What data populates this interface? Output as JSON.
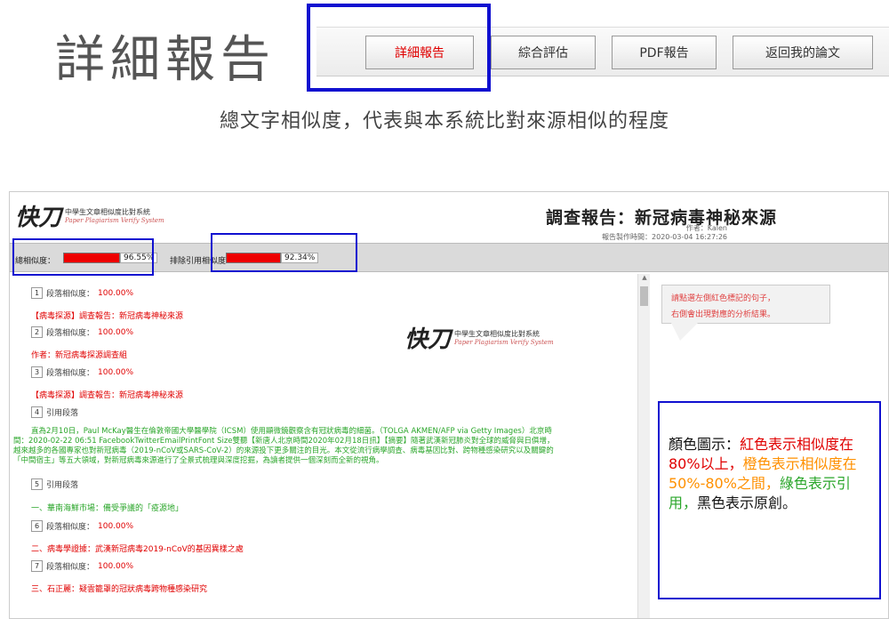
{
  "header": {
    "title": "詳細報告",
    "nav": [
      "詳細報告",
      "綜合評估",
      "PDF報告",
      "返回我的論文"
    ],
    "active_color": "#e00000"
  },
  "subtitle": "總文字相似度，代表與本系統比對來源相似的程度",
  "report": {
    "logo": {
      "mark": "快刀",
      "line1": "中學生文章相似度比對系統",
      "line2": "Paper Plagiarism Verify System"
    },
    "title": "調查報告：新冠病毒神秘來源",
    "author": "作者：Kalen",
    "created": "報告製作時間：2020-03-04 16:27:26",
    "similarity": {
      "total_label": "總相似度：",
      "total_value": "96.55%",
      "total_fraction": 0.9655,
      "excl_label": "排除引用相似度",
      "excl_value": "92.34%",
      "excl_fraction": 0.9234
    },
    "paragraphs": [
      {
        "num": "1",
        "label": "段落相似度：",
        "value": "100.00%",
        "text": "【病毒探源】調查報告：新冠病毒神秘來源"
      },
      {
        "num": "2",
        "label": "段落相似度：",
        "value": "100.00%",
        "text": "作者：新冠病毒探源調查組"
      },
      {
        "num": "3",
        "label": "段落相似度：",
        "value": "100.00%",
        "text": "【病毒探源】調查報告：新冠病毒神秘來源"
      },
      {
        "num": "4",
        "label": "引用段落",
        "value": "",
        "text": ""
      },
      {
        "num": "5",
        "label": "引用段落",
        "value": "",
        "text": "一、華南海鮮市場：備受爭議的「疫源地」"
      },
      {
        "num": "6",
        "label": "段落相似度：",
        "value": "100.00%",
        "text": "二、病毒學證據：武漢新冠病毒2019-nCoV的基因異樣之處"
      },
      {
        "num": "7",
        "label": "段落相似度：",
        "value": "100.00%",
        "text": "三、石正麗：疑雲籠罩的冠狀病毒跨物種感染研究"
      }
    ],
    "quote_lines": [
      "直為2月10日，Paul McKay醫生在倫敦帝國大學醫學院（ICSM）使用顯微鏡觀察含有冠狀病毒的細菌。（TOLGA AKMEN/AFP via Getty Images）北京時",
      "間：2020-02-22 06:51 FacebookTwitterEmailPrintFont Size雙聽【新唐人北京時間2020年02月18日訊】【摘要】隨著武漢新冠肺炎對全球的威脅與日俱增，",
      "越來越多的各國專家也對新冠病毒（2019-nCoV或SARS-CoV-2）的來源投下更多關注的目光。本文從流行病學調查、病毒基因比對、跨物種感染研究以及關鍵的",
      "「中間宿主」等五大領域，對新冠病毒來源進行了全景式梳理與深度挖掘，為讀者提供一個深刻而全新的視角。"
    ],
    "tip": [
      "請點選左側紅色標記的句子，",
      "右側會出現對應的分析結果。"
    ]
  },
  "legend": {
    "prefix": "顏色圖示：",
    "red_text": "紅色表示相似度在80%以上，",
    "orange_text": "橙色表示相似度在50%-80%之間，",
    "green_text": "綠色表示引用，",
    "black_text": "黑色表示原創。",
    "colors": {
      "red": "#e00000",
      "orange": "#ff9000",
      "green": "#2aa62a",
      "black": "#111111",
      "highlight_box": "#1010d0"
    }
  }
}
